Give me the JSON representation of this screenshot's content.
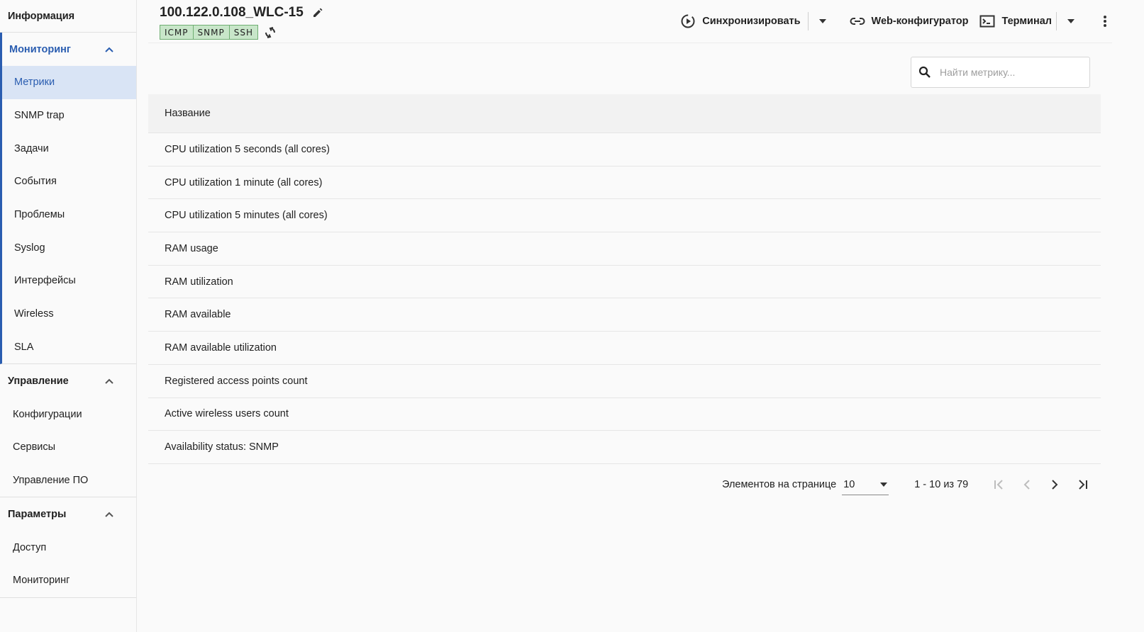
{
  "sidebar": {
    "header": "Информация",
    "monitoring": {
      "title": "Мониторинг",
      "items": [
        "Метрики",
        "SNMP trap",
        "Задачи",
        "События",
        "Проблемы",
        "Syslog",
        "Интерфейсы",
        "Wireless",
        "SLA"
      ],
      "selected_index": 0
    },
    "management": {
      "title": "Управление",
      "items": [
        "Конфигурации",
        "Сервисы",
        "Управление ПО"
      ]
    },
    "params": {
      "title": "Параметры",
      "items": [
        "Доступ",
        "Мониторинг"
      ]
    }
  },
  "header": {
    "device_name": "100.122.0.108_WLC-15",
    "protocols": [
      "ICMP",
      "SNMP",
      "SSH"
    ],
    "sync_label": "Синхронизировать",
    "web_label": "Web-конфигуратор",
    "terminal_label": "Терминал"
  },
  "search": {
    "placeholder": "Найти метрику..."
  },
  "table": {
    "column": "Название",
    "rows": [
      "CPU utilization 5 seconds (all cores)",
      "CPU utilization 1 minute (all cores)",
      "CPU utilization 5 minutes (all cores)",
      "RAM usage",
      "RAM utilization",
      "RAM available",
      "RAM available utilization",
      "Registered access points count",
      "Active wireless users count",
      "Availability status: SNMP"
    ]
  },
  "pagination": {
    "per_page_label": "Элементов на странице",
    "per_page_value": "10",
    "range_text": "1 - 10 из 79"
  },
  "colors": {
    "accent": "#2a5db0",
    "selected_bg": "#d9e4f5",
    "badge_bg": "#c8e6c9"
  }
}
